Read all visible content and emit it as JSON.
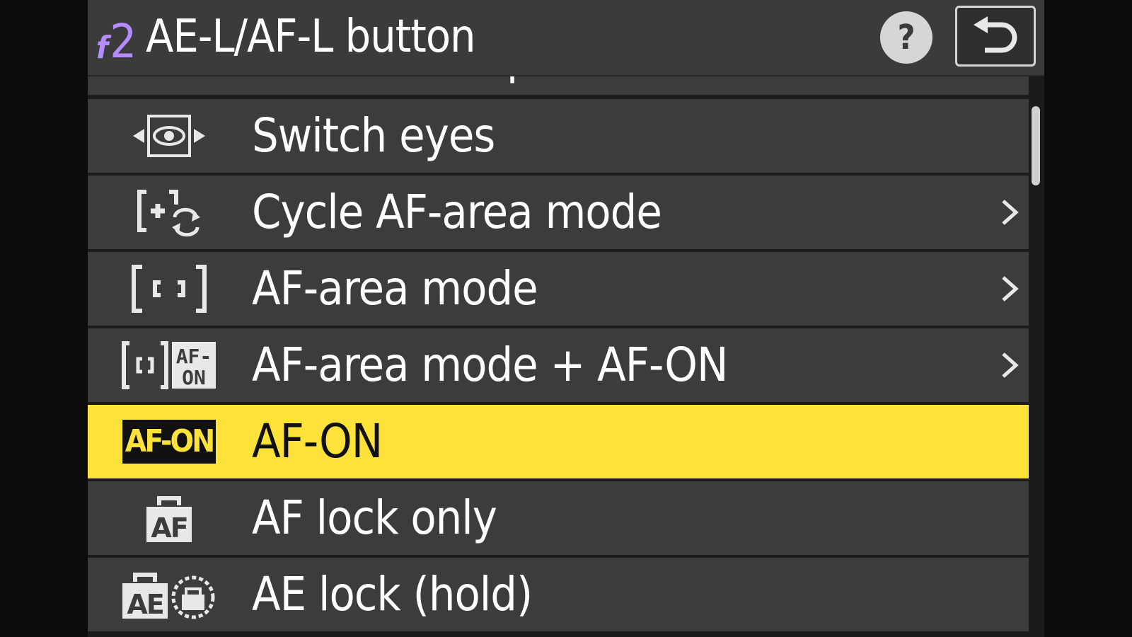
{
  "header": {
    "menu_code_letter": "f",
    "menu_code_number": "2",
    "title": "AE-L/AF-L button",
    "help_label": "?",
    "back_icon": "back-arrow-icon"
  },
  "list": {
    "items": [
      {
        "label": "Recall focus position",
        "icon": "recall-focus-icon",
        "has_submenu": false,
        "selected": false
      },
      {
        "label": "Switch eyes",
        "icon": "switch-eyes-icon",
        "has_submenu": false,
        "selected": false
      },
      {
        "label": "Cycle AF-area mode",
        "icon": "cycle-af-area-icon",
        "has_submenu": true,
        "selected": false
      },
      {
        "label": "AF-area mode",
        "icon": "af-area-mode-icon",
        "has_submenu": true,
        "selected": false
      },
      {
        "label": "AF-area mode + AF-ON",
        "icon": "af-area-afon-icon",
        "has_submenu": true,
        "selected": false
      },
      {
        "label": "AF-ON",
        "icon": "afon-icon",
        "icon_text": "AF-ON",
        "has_submenu": false,
        "selected": true
      },
      {
        "label": "AF lock only",
        "icon": "af-lock-icon",
        "icon_text": "AF",
        "has_submenu": false,
        "selected": false
      },
      {
        "label": "AE lock (hold)",
        "icon": "ae-lock-hold-icon",
        "icon_text": "AE",
        "has_submenu": false,
        "selected": false
      }
    ]
  },
  "colors": {
    "background": "#1b1b1b",
    "row": "#3c3c3c",
    "header": "#3b3b3b",
    "selection": "#fde23a",
    "menu_code": "#b48cff",
    "text": "#ffffff"
  }
}
